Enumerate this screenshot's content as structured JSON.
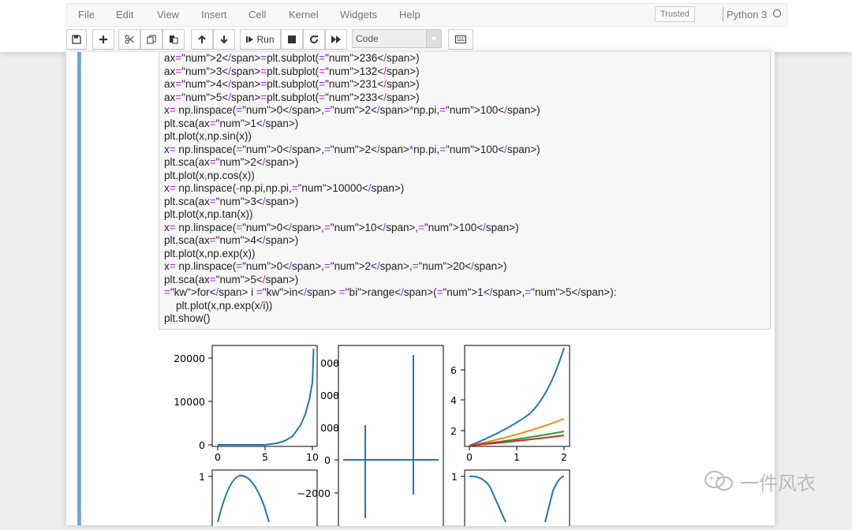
{
  "menu": {
    "items": [
      "File",
      "Edit",
      "View",
      "Insert",
      "Cell",
      "Kernel",
      "Widgets",
      "Help"
    ],
    "trusted": "Trusted",
    "kernel": "Python 3"
  },
  "toolbar": {
    "run_label": "Run",
    "cell_type": "Code"
  },
  "code_lines": [
    "ax2=plt.subplot(236)",
    "ax3=plt.subplot(132)",
    "ax4=plt.subplot(231)",
    "ax5=plt.subplot(233)",
    "x= np.linspace(0,2*np.pi,100)",
    "plt.sca(ax1)",
    "plt.plot(x,np.sin(x))",
    "x= np.linspace(0,2*np.pi,100)",
    "plt.sca(ax2)",
    "plt.plot(x,np.cos(x))",
    "x= np.linspace(-np.pi,np.pi,10000)",
    "plt.sca(ax3)",
    "plt.plot(x,np.tan(x))",
    "x= np.linspace(0,10,100)",
    "plt.sca(ax4)",
    "plt.plot(x,np.exp(x))",
    "x= np.linspace(0,2,20)",
    "plt.sca(ax5)",
    "for i in range(1,5):",
    "    plt.plot(x,np.exp(x/i))",
    "plt.show()"
  ],
  "plots": {
    "exp_yticks": [
      "20000",
      "10000",
      "0"
    ],
    "exp_xticks": [
      "0",
      "5",
      "10"
    ],
    "tan_yticks": [
      "000",
      "000",
      "000",
      "0",
      "−2000"
    ],
    "multi_yticks": [
      "6",
      "4",
      "2"
    ],
    "multi_xticks": [
      "0",
      "1",
      "2"
    ],
    "sin_ytick": "1",
    "cos_ytick": "1"
  },
  "colors": {
    "series": [
      "#1f77b4",
      "#ff7f0e",
      "#2ca02c",
      "#d62728"
    ],
    "selected_cell": "#66a9de"
  },
  "watermark": "一件风衣"
}
